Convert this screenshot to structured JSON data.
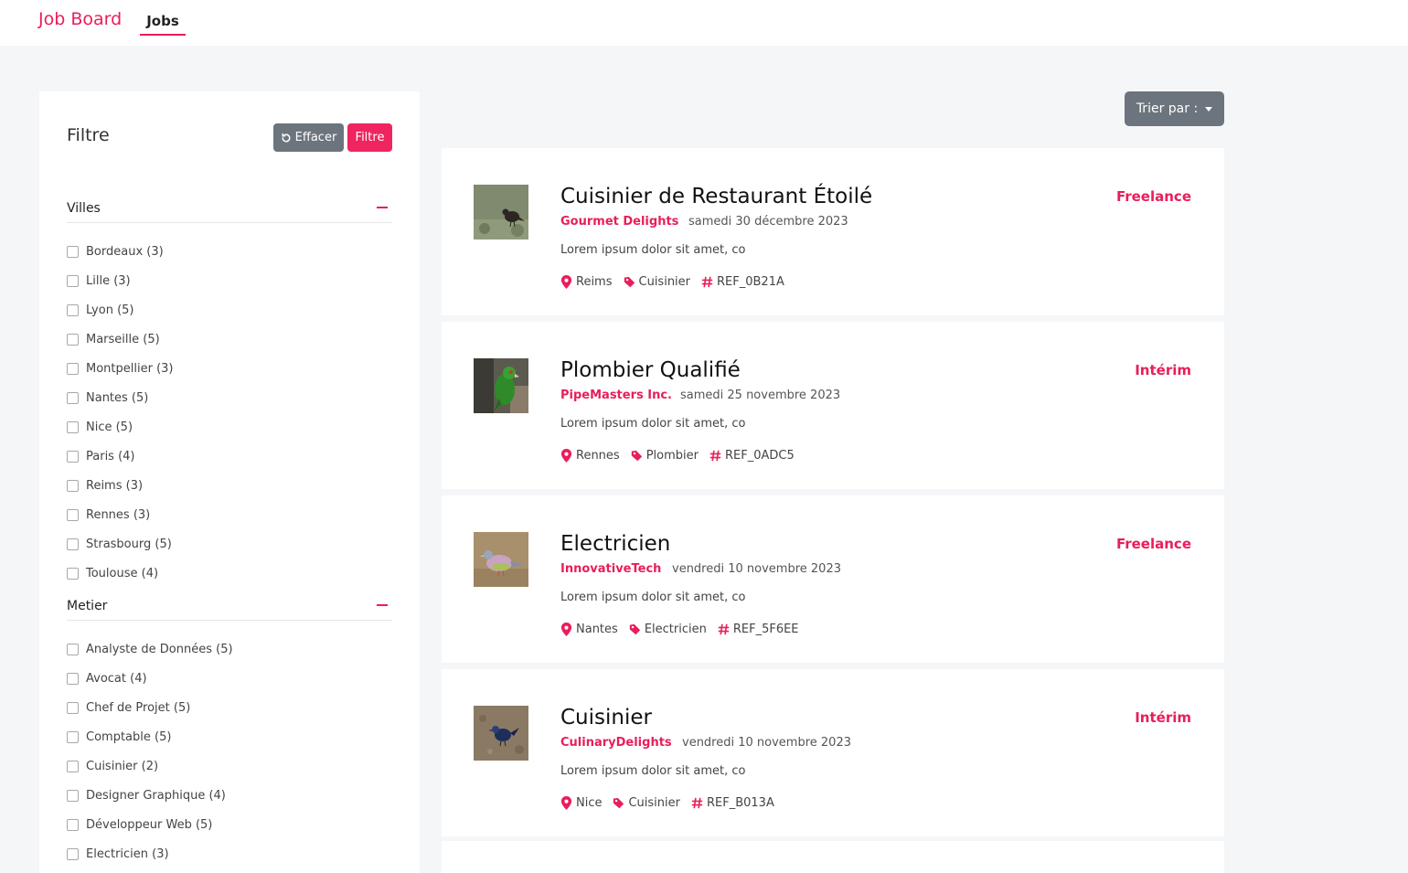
{
  "header": {
    "brand": "Job Board",
    "nav_jobs": "Jobs"
  },
  "sidebar": {
    "title": "Filtre",
    "clear_label": "Effacer",
    "filter_label": "Filtre",
    "villes_title": "Villes",
    "metier_title": "Metier",
    "villes": [
      "Bordeaux (3)",
      "Lille (3)",
      "Lyon (5)",
      "Marseille (5)",
      "Montpellier (3)",
      "Nantes (5)",
      "Nice (5)",
      "Paris (4)",
      "Reims (3)",
      "Rennes (3)",
      "Strasbourg (5)",
      "Toulouse (4)"
    ],
    "metiers": [
      "Analyste de Données (5)",
      "Avocat (4)",
      "Chef de Projet (5)",
      "Comptable (5)",
      "Cuisinier (2)",
      "Designer Graphique (4)",
      "Développeur Web (5)",
      "Electricien (3)"
    ]
  },
  "sort": {
    "label": "Trier par :"
  },
  "jobs": [
    {
      "title": "Cuisinier de Restaurant Étoilé",
      "company": "Gourmet Delights",
      "date": "samedi 30 décembre 2023",
      "description": "Lorem ipsum dolor sit amet, co",
      "city": "Reims",
      "category": "Cuisinier",
      "ref": "REF_0B21A",
      "type": "Freelance"
    },
    {
      "title": "Plombier Qualifié",
      "company": "PipeMasters Inc.",
      "date": "samedi 25 novembre 2023",
      "description": "Lorem ipsum dolor sit amet, co",
      "city": "Rennes",
      "category": "Plombier",
      "ref": "REF_0ADC5",
      "type": "Intérim"
    },
    {
      "title": "Electricien",
      "company": "InnovativeTech",
      "date": "vendredi 10 novembre 2023",
      "description": "Lorem ipsum dolor sit amet, co",
      "city": "Nantes",
      "category": "Electricien",
      "ref": "REF_5F6EE",
      "type": "Freelance"
    },
    {
      "title": "Cuisinier",
      "company": "CulinaryDelights",
      "date": "vendredi 10 novembre 2023",
      "description": "Lorem ipsum dolor sit amet, co",
      "city": "Nice",
      "category": "Cuisinier",
      "ref": "REF_B013A",
      "type": "Intérim"
    }
  ],
  "colors": {
    "accent": "#e91e5a",
    "button_gray": "#6c757d",
    "background": "#f5f6f8"
  },
  "icons": {
    "location": "map-pin-icon",
    "category": "tag-icon",
    "reference": "hash-icon",
    "clear": "undo-icon"
  }
}
